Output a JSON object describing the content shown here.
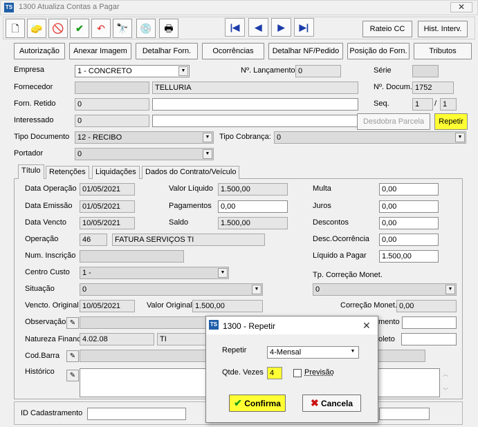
{
  "window": {
    "title": "1300 Atualiza Contas a Pagar",
    "close": "✕",
    "icon": "app-logo-icon",
    "logo_text": "TS"
  },
  "toolbar": {
    "icons": [
      "new-document-icon",
      "eraser-icon",
      "cancel-icon",
      "confirm-check-icon",
      "undo-icon",
      "binoculars-search-icon",
      "settings-disk-icon",
      "printer-icon"
    ],
    "nav": {
      "first": "|◀",
      "prev": "◀",
      "next": "▶",
      "last": "▶|"
    },
    "rateio": "Rateio CC",
    "hist": "Hist. Interv."
  },
  "actions": {
    "autorizacao": "Autorização",
    "anexar": "Anexar Imagem",
    "detalhar_forn": "Detalhar Forn.",
    "ocorrencias": "Ocorrências",
    "detalhar_nf": "Detalhar NF/Pedido",
    "posicao": "Posição do Forn.",
    "tributos": "Tributos"
  },
  "form": {
    "empresa_label": "Empresa",
    "empresa_value": "1 - CONCRETO",
    "lancamento_label": "Nº. Lançamento",
    "lancamento_value": "0",
    "serie_label": "Série",
    "serie_value": "",
    "fornecedor_label": "Fornecedor",
    "fornecedor_code": "",
    "fornecedor_name": "TELLURIA",
    "docum_label": "Nº. Docum.",
    "docum_value": "1752",
    "forn_retido_label": "Forn. Retido",
    "forn_retido_code": "0",
    "forn_retido_name": "",
    "seq_label": "Seq.",
    "seq_value": "1",
    "seq_sep": "/",
    "seq_total": "1",
    "interessado_label": "Interessado",
    "interessado_code": "0",
    "interessado_name": "",
    "desdobra": "Desdobra Parcela",
    "repetir": "Repetir",
    "tipo_doc_label": "Tipo Documento",
    "tipo_doc_value": "12 - RECIBO",
    "tipo_cobranca_label": "Tipo Cobrança:",
    "tipo_cobranca_value": "0",
    "portador_label": "Portador",
    "portador_value": "0"
  },
  "tabs": [
    "Título",
    "Retenções",
    "Liquidações",
    "Dados do Contrato/Veículo"
  ],
  "titulo": {
    "data_operacao_label": "Data Operação",
    "data_operacao": "01/05/2021",
    "valor_liquido_label": "Valor Líquido",
    "valor_liquido": "1.500,00",
    "multa_label": "Multa",
    "multa": "0,00",
    "data_emissao_label": "Data Emissão",
    "data_emissao": "01/05/2021",
    "pagamentos_label": "Pagamentos",
    "pagamentos": "0,00",
    "juros_label": "Juros",
    "juros": "0,00",
    "data_vencto_label": "Data Vencto",
    "data_vencto": "10/05/2021",
    "saldo_label": "Saldo",
    "saldo": "1.500,00",
    "descontos_label": "Descontos",
    "descontos": "0,00",
    "operacao_label": "Operação",
    "operacao_code": "46",
    "operacao_name": "FATURA SERVIÇOS TI",
    "desc_ocorrencia_label": "Desc.Ocorrência",
    "desc_ocorrencia": "0,00",
    "num_inscricao_label": "Num. Inscrição",
    "num_inscricao": "",
    "liquido_pagar_label": "Líquido a Pagar",
    "liquido_pagar": "1.500,00",
    "centro_custo_label": "Centro Custo",
    "centro_custo": "1 -",
    "tp_correcao_label": "Tp. Correção Monet.",
    "situacao_label": "Situação",
    "situacao": "0",
    "tp_correcao": "0",
    "vencto_original_label": "Vencto. Original",
    "vencto_original": "10/05/2021",
    "valor_original_label": "Valor Original",
    "valor_original": "1.500,00",
    "correcao_label": "Correção Monet.",
    "correcao": "0,00",
    "observacao_label": "Observação",
    "partial_label_1": "mento",
    "natureza_label": "Natureza Financ",
    "natureza_code": "4.02.08",
    "natureza_name": "TI",
    "partial_label_2": "oleto",
    "codbarra_label": "Cod.Barra",
    "historico_label": "Histórico"
  },
  "footer": {
    "id_label": "ID Cadastramento",
    "id_value": ""
  },
  "dialog": {
    "title": "1300 - Repetir",
    "close": "✕",
    "repetir_label": "Repetir",
    "repetir_value": "4-Mensal",
    "qtde_label": "Qtde. Vezes",
    "qtde_value": "4",
    "previsao_label": "Previsão",
    "confirma": "Confirma",
    "cancela": "Cancela"
  }
}
